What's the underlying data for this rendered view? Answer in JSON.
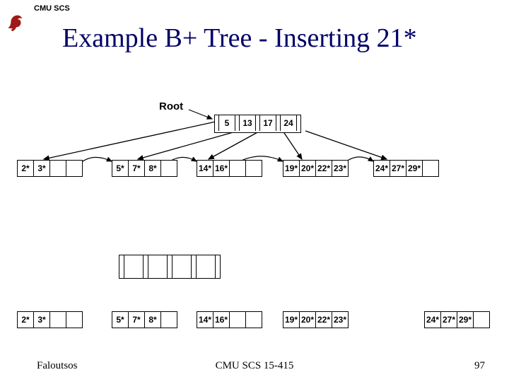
{
  "header": {
    "org": "CMU SCS"
  },
  "title": "Example B+ Tree - Inserting 21*",
  "root_label": "Root",
  "top": {
    "root": [
      "5",
      "13",
      "17",
      "24"
    ],
    "leaf1": [
      "2*",
      "3*",
      "",
      "",
      ""
    ],
    "leaf2": [
      "5*",
      "7*",
      "8*",
      "",
      ""
    ],
    "leaf3": [
      "14*",
      "16*",
      "",
      "",
      ""
    ],
    "leaf4": [
      "19*",
      "20*",
      "22*",
      "23*",
      ""
    ],
    "leaf5": [
      "24*",
      "27*",
      "29*",
      "",
      ""
    ]
  },
  "mid_empty": {
    "n": 5
  },
  "bottom": {
    "leaf1": [
      "2*",
      "3*",
      "",
      "",
      ""
    ],
    "leaf2": [
      "5*",
      "7*",
      "8*",
      "",
      ""
    ],
    "leaf3": [
      "14*",
      "16*",
      "",
      "",
      ""
    ],
    "leaf4": [
      "19*",
      "20*",
      "22*",
      "23*",
      ""
    ],
    "leaf5": [
      "24*",
      "27*",
      "29*",
      "",
      ""
    ]
  },
  "footer": {
    "left": "Faloutsos",
    "center": "CMU SCS 15-415",
    "right": "97"
  },
  "chart_data": {
    "type": "table",
    "title": "B+ tree before/after inserting key 21*",
    "before": {
      "root_keys": [
        5,
        13,
        17,
        24
      ],
      "leaves": [
        [
          "2*",
          "3*"
        ],
        [
          "5*",
          "7*",
          "8*"
        ],
        [
          "14*",
          "16*"
        ],
        [
          "19*",
          "20*",
          "22*",
          "23*"
        ],
        [
          "24*",
          "27*",
          "29*"
        ]
      ]
    },
    "insert_key": "21*",
    "after_fragment": {
      "leaves_shown": [
        [
          "2*",
          "3*"
        ],
        [
          "5*",
          "7*",
          "8*"
        ],
        [
          "14*",
          "16*"
        ],
        [
          "19*",
          "20*",
          "22*",
          "23*"
        ],
        [
          "24*",
          "27*",
          "29*"
        ]
      ]
    }
  }
}
